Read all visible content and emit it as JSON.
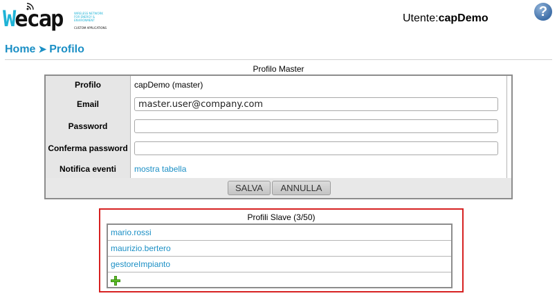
{
  "header": {
    "logo_wifi_mark": "wifi-icon",
    "logo_text_w": "W",
    "logo_text_rest": "ecap",
    "logo_tagline": "Wireless Network for Energy & Environment",
    "logo_tagline2": "Custom Applications",
    "user_label": "Utente:",
    "user_name": "capDemo",
    "help_icon": "question-mark-icon",
    "help_glyph": "?"
  },
  "breadcrumb": {
    "home": "Home",
    "separator": "➤",
    "current": "Profilo"
  },
  "master": {
    "caption": "Profilo Master",
    "rows": {
      "profilo": {
        "label": "Profilo",
        "value": "capDemo (master)"
      },
      "email": {
        "label": "Email",
        "value": "master.user@company.com"
      },
      "password": {
        "label": "Password",
        "value": ""
      },
      "confirm": {
        "label": "Conferma password",
        "value": ""
      },
      "notify": {
        "label": "Notifica eventi",
        "link": "mostra tabella"
      }
    },
    "buttons": {
      "save": "SALVA",
      "cancel": "ANNULLA"
    }
  },
  "slave": {
    "caption": "Profili Slave (3/50)",
    "items": [
      "mario.rossi",
      "maurizio.bertero",
      "gestoreImpianto"
    ],
    "add_icon": "plus-icon"
  },
  "colors": {
    "brand": "#1fb3d6",
    "link": "#1b8fc5",
    "highlight_border": "#d62020"
  }
}
